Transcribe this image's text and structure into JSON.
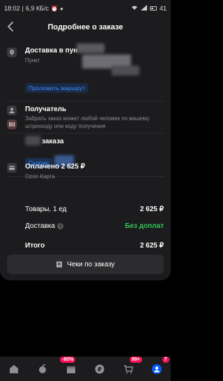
{
  "status_bar": {
    "time": "18:02",
    "speed": "6,9 КБ/с",
    "battery": "41"
  },
  "header": {
    "title": "Подробнее о заказе"
  },
  "delivery": {
    "title": "Доставка в пун",
    "subtitle": "Пункт",
    "link": "Проложить маршрут"
  },
  "recipient": {
    "title": "Получатель",
    "text": "Забрать заказ может любой человек по вашему штрихкоду или коду получения"
  },
  "order": {
    "title": "заказа",
    "copy": "Скопир"
  },
  "payment": {
    "title": "Оплачено 2 625 ₽",
    "method": "Ozon Карта",
    "goods_label": "Товары, 1 ед",
    "goods_value": "2 625 ₽",
    "delivery_label": "Доставка",
    "delivery_value": "Без доплат",
    "total_label": "Итого",
    "total_value": "2 625 ₽"
  },
  "receipt_button": "Чеки по заказу",
  "nav": {
    "badge_discount": "-80%",
    "badge_points": "99+",
    "badge_profile": "7"
  },
  "colors": {
    "accent_blue": "#3d8bff",
    "green": "#34c759",
    "badge_pink": "#f91155"
  }
}
